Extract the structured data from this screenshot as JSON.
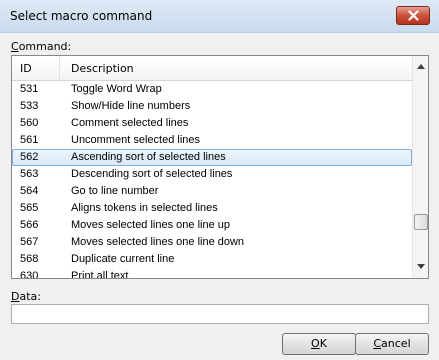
{
  "window": {
    "title": "Select macro command"
  },
  "command_label": {
    "accel": "C",
    "rest": "ommand:"
  },
  "list": {
    "columns": {
      "id": "ID",
      "description": "Description"
    },
    "selected_index": 4,
    "rows": [
      {
        "id": "531",
        "description": "Toggle Word Wrap"
      },
      {
        "id": "533",
        "description": "Show/Hide line numbers"
      },
      {
        "id": "560",
        "description": "Comment selected lines"
      },
      {
        "id": "561",
        "description": "Uncomment selected lines"
      },
      {
        "id": "562",
        "description": "Ascending sort of selected lines"
      },
      {
        "id": "563",
        "description": "Descending sort of selected lines"
      },
      {
        "id": "564",
        "description": "Go to line number"
      },
      {
        "id": "565",
        "description": "Aligns tokens in selected lines"
      },
      {
        "id": "566",
        "description": "Moves selected lines one line up"
      },
      {
        "id": "567",
        "description": "Moves selected lines one line down"
      },
      {
        "id": "568",
        "description": "Duplicate current line"
      },
      {
        "id": "630",
        "description": "Print all text"
      }
    ]
  },
  "data_label": {
    "accel": "D",
    "rest": "ata:"
  },
  "data_field": {
    "value": ""
  },
  "buttons": {
    "ok": {
      "accel": "O",
      "rest": "K"
    },
    "cancel": {
      "accel": "C",
      "rest": "ancel"
    }
  },
  "colors": {
    "selection_border": "#84acdd",
    "close_button": "#c9523d"
  }
}
